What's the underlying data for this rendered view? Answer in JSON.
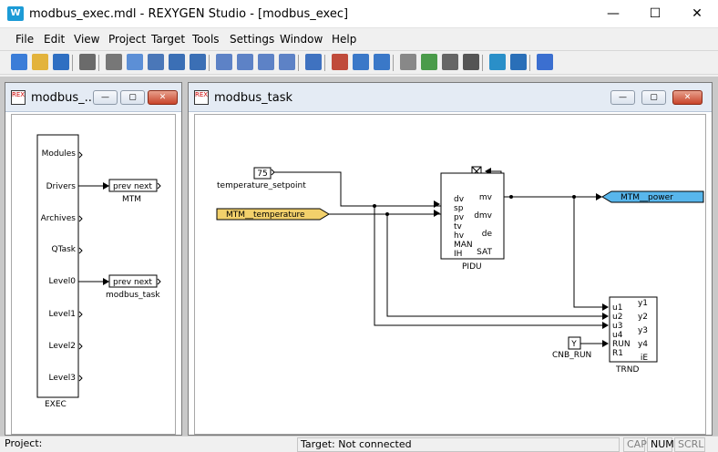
{
  "window": {
    "title": "modbus_exec.mdl - REXYGEN Studio - [modbus_exec]",
    "app_icon": "W",
    "minimize": "—",
    "maximize": "☐",
    "close": "✕"
  },
  "menu": [
    "File",
    "Edit",
    "View",
    "Project",
    "Target",
    "Tools",
    "Settings",
    "Window",
    "Help"
  ],
  "left_window": {
    "title": "modbus_...",
    "min": "—",
    "max": "▢",
    "close": "✕",
    "exec": {
      "title": "EXEC",
      "ports": [
        "Modules",
        "Drivers",
        "Archives",
        "QTask",
        "Level0",
        "Level1",
        "Level2",
        "Level3"
      ]
    },
    "mtm": {
      "text": "prev  next",
      "label": "MTM"
    },
    "modbus_task": {
      "text": "prev  next",
      "label": "modbus_task"
    }
  },
  "right_window": {
    "title": "modbus_task",
    "min": "—",
    "max": "▢",
    "close": "✕",
    "const_value": "75",
    "const_label": "temperature_setpoint",
    "input_label": "MTM__temperature",
    "output_label": "MTM__power",
    "pidu": {
      "name": "PIDU",
      "inputs": [
        "dv",
        "sp",
        "pv",
        "tv",
        "hv",
        "MAN",
        "IH"
      ],
      "outputs": [
        "mv",
        "dmv",
        "de",
        "SAT"
      ]
    },
    "trnd": {
      "name": "TRND",
      "inputs": [
        "u1",
        "u2",
        "u3",
        "u4",
        "RUN",
        "R1"
      ],
      "outputs": [
        "y1",
        "y2",
        "y3",
        "y4",
        "iE"
      ]
    },
    "cnb_value": "Y",
    "cnb_label": "CNB_RUN"
  },
  "status": {
    "project": "Project:",
    "target": "Target: Not connected",
    "cap": "CAP",
    "num": "NUM",
    "scrl": "SCRL"
  },
  "colors": {
    "input_tag": "#f2d06b",
    "output_tag": "#58b6ec",
    "title_bg": "#e4ebf4"
  },
  "toolbar_icons": [
    "new-icon",
    "open-icon",
    "save-icon",
    "print-icon",
    "cut-icon",
    "copy-icon",
    "paste-icon",
    "undo-icon",
    "redo-icon",
    "zoom-in-icon",
    "zoom-out-icon",
    "zoom-fit-icon",
    "zoom-select-icon",
    "block-icon",
    "compile-icon",
    "download-icon",
    "upload-icon",
    "library-icon",
    "add-icon",
    "settings-icon",
    "list-icon",
    "watch-icon",
    "monitor-icon",
    "info-icon"
  ]
}
